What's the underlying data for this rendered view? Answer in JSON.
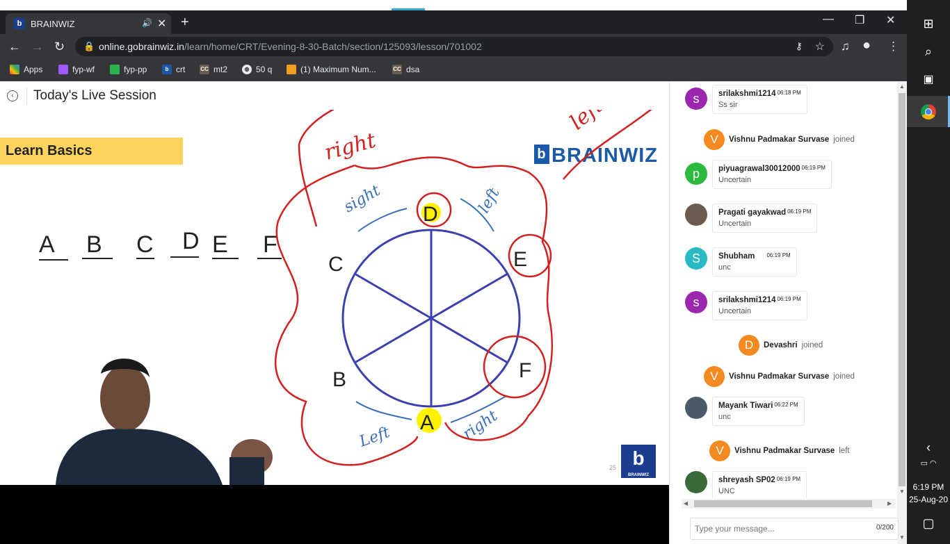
{
  "browser": {
    "tab_title": "BRAINWIZ",
    "tab_favicon": "b",
    "url_host": "online.gobrainwiz.in",
    "url_path": "/learn/home/CRT/Evening-8-30-Batch/section/125093/lesson/701002",
    "bookmarks": [
      {
        "label": "Apps",
        "icon": "apps-grid-icon"
      },
      {
        "label": "fyp-wf",
        "icon": "figma-icon"
      },
      {
        "label": "fyp-pp",
        "icon": "pd-icon"
      },
      {
        "label": "crt",
        "icon": "brainwiz-icon"
      },
      {
        "label": "mt2",
        "icon": "cc-icon"
      },
      {
        "label": "50 q",
        "icon": "globe-icon"
      },
      {
        "label": "(1) Maximum Num...",
        "icon": "leetcode-icon"
      },
      {
        "label": "dsa",
        "icon": "cc-icon"
      }
    ]
  },
  "page": {
    "title": "Today's Live Session"
  },
  "slide": {
    "banner": "Learn Basics",
    "logo": "BRAINWIZ",
    "logo_letter": "b",
    "page_number": "25",
    "small_logo_text": "BRAINWIZ",
    "letters": [
      "A",
      "B",
      "C",
      "D",
      "E",
      "F"
    ],
    "circle_labels": [
      "D",
      "E",
      "F",
      "A",
      "B",
      "C"
    ],
    "annotations": [
      "right",
      "left",
      "sight",
      "left",
      "Left",
      "right"
    ]
  },
  "chat": {
    "messages": [
      {
        "type": "msg",
        "avatar": "s",
        "avatar_color": "#9b27af",
        "name": "srilakshmi1214",
        "time": "06:18 PM",
        "text": "Ss sir"
      },
      {
        "type": "join",
        "avatar": "V",
        "name": "Vishnu Padmakar Survase",
        "action": "joined"
      },
      {
        "type": "msg",
        "avatar": "p",
        "avatar_color": "#2bba3e",
        "name": "piyuagrawal30012000",
        "time": "06:19 PM",
        "text": "Uncertain"
      },
      {
        "type": "msg",
        "avatar": "",
        "avatar_color": "#6b5a4e",
        "name": "Pragati gayakwad",
        "time": "06:19 PM",
        "text": "Uncertain"
      },
      {
        "type": "msg",
        "avatar": "S",
        "avatar_color": "#28b9c4",
        "name": "Shubham",
        "time": "06:19 PM",
        "text": "unc"
      },
      {
        "type": "msg",
        "avatar": "s",
        "avatar_color": "#9b27af",
        "name": "srilakshmi1214",
        "time": "06:19 PM",
        "text": "Uncertain"
      },
      {
        "type": "join",
        "avatar": "D",
        "name": "Devashri",
        "action": "joined"
      },
      {
        "type": "join",
        "avatar": "V",
        "name": "Vishnu Padmakar Survase",
        "action": "joined"
      },
      {
        "type": "msg",
        "avatar": "",
        "avatar_color": "#4a5a6a",
        "name": "Mayank Tiwari",
        "time": "06:22 PM",
        "text": "unc"
      },
      {
        "type": "join",
        "avatar": "V",
        "name": "Vishnu Padmakar Survase",
        "action": "left"
      },
      {
        "type": "msg",
        "avatar": "",
        "avatar_color": "#3a6a3a",
        "name": "shreyash SP02",
        "time": "06:19 PM",
        "text": "UNC"
      }
    ],
    "input_placeholder": "Type your message...",
    "char_count": "0/200"
  },
  "taskbar": {
    "time": "6:19 PM",
    "date": "25-Aug-20"
  }
}
